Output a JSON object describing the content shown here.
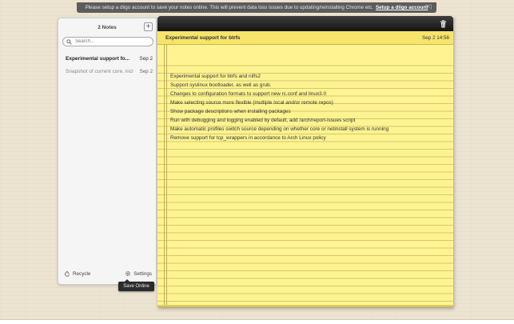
{
  "banner": {
    "message": "Please setup a diigo account to save your notes online. This will prevent data loss issues due to updating/reinstalling Chrome etc.",
    "link_label": "Setup a diigo account",
    "close_label": "[X]"
  },
  "sidebar": {
    "title": "2 Notes",
    "add_label": "+",
    "search_placeholder": "Search...",
    "notes": [
      {
        "title": "Experimental support fo...",
        "date": "Sep 2"
      },
      {
        "title": "Snapshot of current core, incl",
        "date": "Sep 2"
      }
    ],
    "recycle_label": "Recycle",
    "settings_label": "Settings",
    "tooltip": "Save Online"
  },
  "note": {
    "title": "Experimental support for btrfs",
    "date": "Sep 2 14:56",
    "lines": [
      "Experimental support for btrfs and nilfs2",
      "Support syslinux bootloader, as well as grub.",
      "Changes to configuration formats to support new rc.conf and linux3.0",
      "Make selecting source more flexible (multiple local and/or remote repos)",
      "Show package descriptions when installing packages",
      "Run with debugging and logging enabled by default, add /arch/report-issues script",
      "Make automatic profiles switch source depending on whether core or netinstall system is running",
      "Remove support for tcp_wrappers in accordance to Arch Linux policy"
    ]
  },
  "colors": {
    "paper": "#fdf491",
    "paper_header": "#f6e46b",
    "toolbar": "#1f1f1f",
    "banner": "#5c5c5c"
  }
}
